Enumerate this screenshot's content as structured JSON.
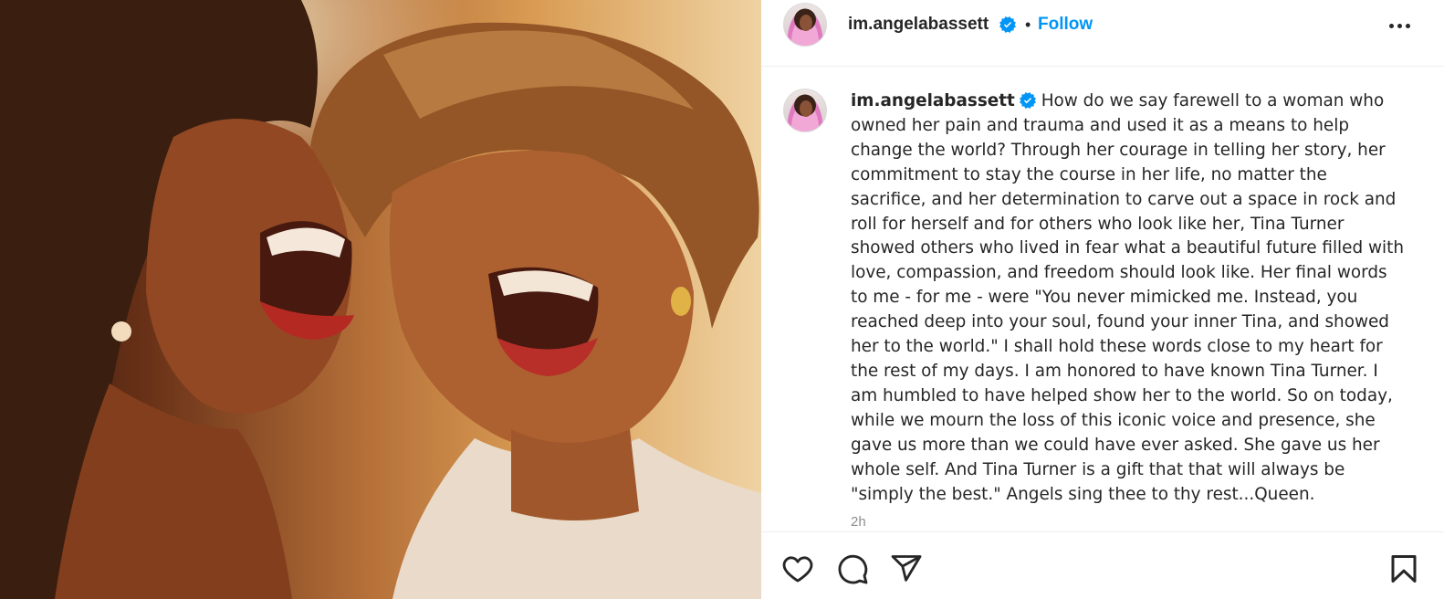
{
  "post": {
    "image_alt_icon": "photo-of-two-laughing-women",
    "author": {
      "username": "im.angelabassett",
      "verified": true,
      "verified_icon": "verified-badge-icon",
      "avatar_icon": "profile-avatar"
    },
    "header": {
      "separator": "•",
      "follow_label": "Follow",
      "more_icon": "more-options-icon"
    },
    "caption": {
      "text": "How do we say farewell to a woman who owned her pain and trauma and used it as a means to help change the world? Through her courage in telling her story, her commitment to stay the course in her life, no matter the sacrifice, and her determination to carve out a space in rock and roll for herself and for others who look like her, Tina Turner showed others who lived in fear what a beautiful future filled with love, compassion, and freedom should look like. Her final words to me - for me - were \"You never mimicked me. Instead, you reached deep into your soul, found your inner Tina, and showed her to the world.\" I shall hold these words close to my heart for the rest of my days. I am honored to have known Tina Turner. I am humbled to have helped show her to the world. So on today, while we mourn the loss of this iconic voice and presence, she gave us more than we could have ever asked. She gave us her whole self. And Tina Turner is a gift that that will always be \"simply the best.\" Angels sing thee to thy rest...Queen.",
      "timestamp": "2h"
    },
    "actions": {
      "like_icon": "heart-icon",
      "comment_icon": "comment-bubble-icon",
      "share_icon": "paper-plane-icon",
      "save_icon": "bookmark-icon"
    }
  },
  "colors": {
    "accent": "#0095f6",
    "text": "#262626",
    "muted": "#8e8e8e",
    "divider": "#efefef"
  }
}
